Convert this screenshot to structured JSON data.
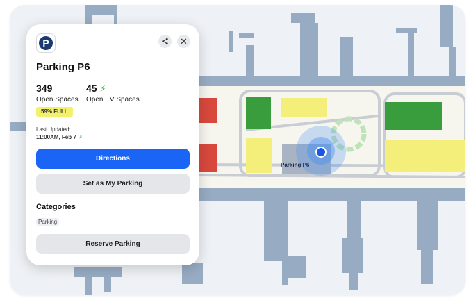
{
  "panel": {
    "title": "Parking P6",
    "open_spaces_value": "349",
    "open_spaces_label": "Open Spaces",
    "ev_spaces_value": "45",
    "ev_spaces_label": "Open EV Spaces",
    "full_badge": "59% FULL",
    "last_updated_label": "Last Updated:",
    "last_updated_time": "11:00AM, Feb 7",
    "directions_label": "Directions",
    "set_my_parking_label": "Set as My Parking",
    "categories_heading": "Categories",
    "category_chip": "Parking",
    "reserve_label": "Reserve Parking",
    "logo_letter": "P"
  },
  "map": {
    "location_label": "Parking P6"
  },
  "icons": [
    "parking-logo-icon",
    "share-icon",
    "close-icon",
    "ev-bolt-icon",
    "live-signal-icon",
    "location-dot-icon"
  ],
  "colors": {
    "accent": "#1a65f5",
    "brand": "#1b3b70",
    "full_badge": "#f3f06b",
    "ev": "#2fb34a",
    "map_green_lot": "#3a9d3d",
    "map_yellow_lot": "#f4ee7a",
    "map_red_lot": "#d8483d",
    "map_building": "#97abc3"
  }
}
